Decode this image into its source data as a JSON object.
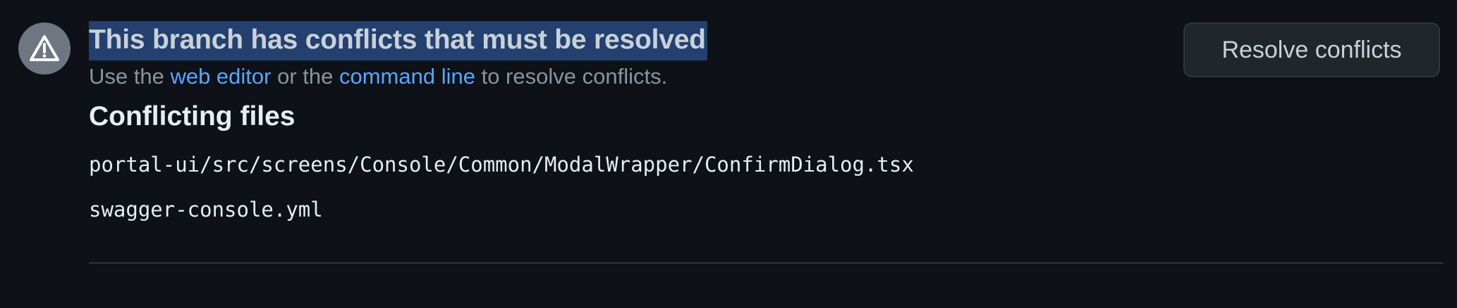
{
  "merge_status": {
    "icon": "alert-triangle-icon",
    "title": "This branch has conflicts that must be resolved",
    "subtitle_parts": {
      "prefix": "Use the ",
      "web_editor_link": "web editor",
      "middle": " or the ",
      "command_line_link": "command line",
      "suffix": " to resolve conflicts."
    },
    "resolve_button_label": "Resolve conflicts"
  },
  "conflicting_files": {
    "heading": "Conflicting files",
    "files": [
      "portal-ui/src/screens/Console/Common/ModalWrapper/ConfirmDialog.tsx",
      "swagger-console.yml"
    ]
  },
  "colors": {
    "background": "#0e1117",
    "title_highlight": "#23406e",
    "link": "#58a6ff",
    "icon_circle": "#6e7681"
  }
}
